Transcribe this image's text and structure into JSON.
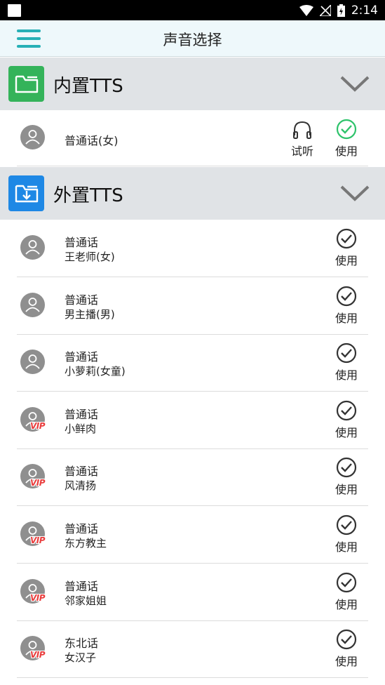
{
  "status_bar": {
    "time": "2:14"
  },
  "app_bar": {
    "title": "声音选择",
    "menu_icon": "hamburger-menu-icon"
  },
  "sections": [
    {
      "title": "内置TTS",
      "icon": "folder-icon",
      "icon_color": "#34b35a",
      "items": [
        {
          "name": "普通话(女)",
          "preview_label": "试听",
          "use_label": "使用",
          "selected": true,
          "vip": false
        }
      ]
    },
    {
      "title": "外置TTS",
      "icon": "folder-download-icon",
      "icon_color": "#1e88e5",
      "items": [
        {
          "name": "普通话",
          "voice": "王老师(女)",
          "use_label": "使用",
          "vip": false
        },
        {
          "name": "普通话",
          "voice": "男主播(男)",
          "use_label": "使用",
          "vip": false
        },
        {
          "name": "普通话",
          "voice": "小萝莉(女童)",
          "use_label": "使用",
          "vip": false
        },
        {
          "name": "普通话",
          "voice": "小鲜肉",
          "use_label": "使用",
          "vip": true
        },
        {
          "name": "普通话",
          "voice": "风清扬",
          "use_label": "使用",
          "vip": true
        },
        {
          "name": "普通话",
          "voice": "东方教主",
          "use_label": "使用",
          "vip": true
        },
        {
          "name": "普通话",
          "voice": "邻家姐姐",
          "use_label": "使用",
          "vip": true
        },
        {
          "name": "东北话",
          "voice": "女汉子",
          "use_label": "使用",
          "vip": true
        }
      ]
    }
  ],
  "vip_badge": "VIP",
  "colors": {
    "accent": "#27b0b6",
    "selected": "#2ec36b",
    "header_bg": "#e0e3e6",
    "appbar_bg": "#eef8fb"
  }
}
